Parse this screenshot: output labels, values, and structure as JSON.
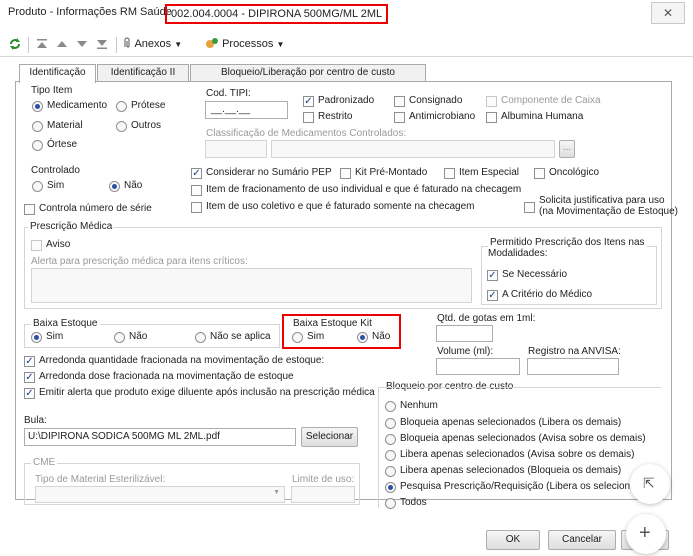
{
  "window": {
    "title": "Produto - Informações RM Saúde",
    "product": "002.004.0004 - DIPIRONA 500MG/ML 2ML",
    "close_glyph": "✕"
  },
  "toolbar": {
    "anexos": "Anexos",
    "processos": "Processos"
  },
  "tabs": [
    "Identificação",
    "Identificação II",
    "Bloqueio/Liberação por centro de custo"
  ],
  "tipo_item": {
    "label": "Tipo Item",
    "options": [
      "Medicamento",
      "Prótese",
      "Material",
      "Outros",
      "Órtese"
    ],
    "selected": "Medicamento"
  },
  "cod_tipi": {
    "label": "Cod. TIPI:",
    "value": "__.__.__"
  },
  "flags": {
    "padronizado": "Padronizado",
    "consignado": "Consignado",
    "componente_caixa": "Componente de Caixa",
    "restrito": "Restrito",
    "antimicrobiano": "Antimicrobiano",
    "albumina": "Albumina Humana"
  },
  "classificacao_label": "Classificação de Medicamentos Controlados:",
  "controlado": {
    "label": "Controlado",
    "sim": "Sim",
    "nao": "Não",
    "selected": "Não"
  },
  "checks_mid": {
    "sumario_pep": "Considerar no Sumário PEP",
    "kit": "Kit Pré-Montado",
    "item_especial": "Item Especial",
    "oncologico": "Oncológico",
    "fracionamento": "Item de fracionamento de uso individual e que é faturado na checagem",
    "uso_coletivo": "Item de uso coletivo e que é faturado somente na checagem",
    "justificativa_1": "Solicita justificativa para uso",
    "justificativa_2": "(na Movimentação de Estoque)"
  },
  "controla_serie": "Controla número de série",
  "prescricao": {
    "label": "Prescrição Médica",
    "aviso": "Aviso",
    "alerta_label": "Alerta para prescrição médica para itens críticos:",
    "permitido_1": "Permitido Prescrição dos Itens nas",
    "permitido_2": "Modalidades:",
    "se_necessario": "Se Necessário",
    "criterio_medico": "A Critério do Médico"
  },
  "baixa_estoque": {
    "label": "Baixa Estoque",
    "sim": "Sim",
    "nao": "Não",
    "nao_aplica": "Não se aplica",
    "selected": "Sim"
  },
  "baixa_estoque_kit": {
    "label": "Baixa Estoque Kit",
    "sim": "Sim",
    "nao": "Não",
    "selected": "Não"
  },
  "qtd_gotas": "Qtd. de gotas em 1ml:",
  "volume": "Volume (ml):",
  "registro_anvisa": "Registro na ANVISA:",
  "arredonda": {
    "qtd": "Arredonda quantidade fracionada na movimentação de estoque:",
    "dose": "Arredonda dose fracionada na movimentação de estoque",
    "diluente": "Emitir alerta que produto exige diluente após inclusão na prescrição médica"
  },
  "bula": {
    "label": "Bula:",
    "value": "U:\\DIPIRONA SODICA 500MG ML 2ML.pdf",
    "button": "Selecionar"
  },
  "cme": {
    "label": "CME",
    "tipo_label": "Tipo de Material Esterilizável:",
    "limite_label": "Limite de uso:"
  },
  "bloqueio": {
    "label": "Bloqueio por centro de custo",
    "options": [
      "Nenhum",
      "Bloqueia apenas selecionados (Libera os demais)",
      "Bloqueia apenas selecionados (Avisa sobre os demais)",
      "Libera apenas selecionados (Avisa sobre os demais)",
      "Libera apenas selecionados (Bloqueia os demais)",
      "Pesquisa Prescrição/Requisição (Libera os selecionac",
      "Todos"
    ],
    "selected": 5
  },
  "footer": {
    "ok": "OK",
    "cancelar": "Cancelar"
  },
  "fab": {
    "expand_glyph": "⇱",
    "plus_glyph": "+"
  }
}
